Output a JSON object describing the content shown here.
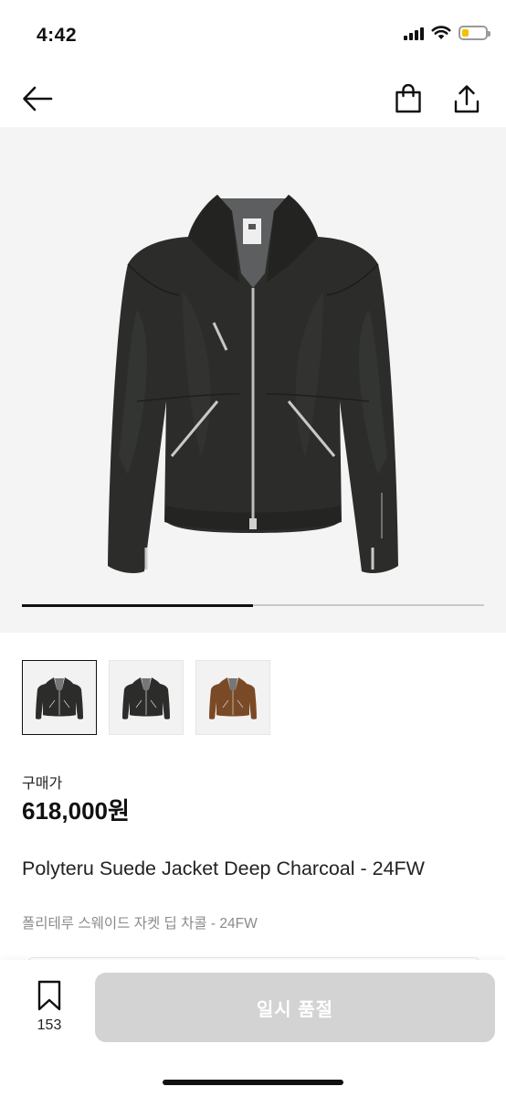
{
  "status_bar": {
    "time": "4:42",
    "signal_icon": "cellular-signal-icon",
    "wifi_icon": "wifi-icon",
    "battery_icon": "battery-icon",
    "battery_level": 0.3,
    "battery_color": "#f2c200"
  },
  "nav": {
    "back_icon": "arrow-left-icon",
    "cart_icon": "shopping-bag-icon",
    "share_icon": "share-icon"
  },
  "gallery": {
    "image_subject": "dark charcoal suede zip-up jacket",
    "carousel_progress": 0.5,
    "thumbnails": [
      {
        "color": "#2c2d2b",
        "selected": true
      },
      {
        "color": "#2c2d2b",
        "selected": false
      },
      {
        "color": "#7a4a26",
        "selected": false
      }
    ]
  },
  "product": {
    "price_label": "구매가",
    "price": "618,000원",
    "title_en": "Polyteru Suede Jacket Deep Charcoal - 24FW",
    "title_ko": "폴리테루 스웨이드 자켓 딥 차콜 - 24FW"
  },
  "bottom_bar": {
    "bookmark_icon": "bookmark-icon",
    "wish_count": "153",
    "buy_button_label": "일시 품절",
    "buy_button_color": "#d3d3d3"
  }
}
